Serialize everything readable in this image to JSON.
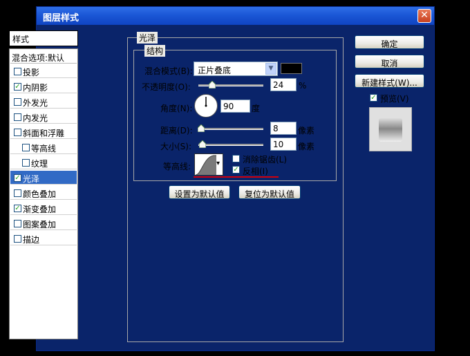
{
  "window": {
    "title": "图层样式",
    "close_glyph": "✕"
  },
  "style_list": {
    "header": "样式",
    "blend_options": "混合选项:默认",
    "items": [
      {
        "label": "投影",
        "checked": false,
        "sub": false,
        "selected": false
      },
      {
        "label": "内阴影",
        "checked": true,
        "sub": false,
        "selected": false
      },
      {
        "label": "外发光",
        "checked": false,
        "sub": false,
        "selected": false
      },
      {
        "label": "内发光",
        "checked": false,
        "sub": false,
        "selected": false
      },
      {
        "label": "斜面和浮雕",
        "checked": false,
        "sub": false,
        "selected": false
      },
      {
        "label": "等高线",
        "checked": false,
        "sub": true,
        "selected": false
      },
      {
        "label": "纹理",
        "checked": false,
        "sub": true,
        "selected": false
      },
      {
        "label": "光泽",
        "checked": true,
        "sub": false,
        "selected": true
      },
      {
        "label": "颜色叠加",
        "checked": false,
        "sub": false,
        "selected": false
      },
      {
        "label": "渐变叠加",
        "checked": true,
        "sub": false,
        "selected": false
      },
      {
        "label": "图案叠加",
        "checked": false,
        "sub": false,
        "selected": false
      },
      {
        "label": "描边",
        "checked": false,
        "sub": false,
        "selected": false
      }
    ],
    "check_glyph": "✓"
  },
  "satin": {
    "group_title": "光泽",
    "structure_title": "结构",
    "blend_mode_label": "混合模式(B):",
    "blend_mode_value": "正片叠底",
    "blend_color": "#000000",
    "opacity_label": "不透明度(O):",
    "opacity_value": "24",
    "opacity_unit": "%",
    "angle_label": "角度(N):",
    "angle_value": "90",
    "angle_unit": "度",
    "distance_label": "距离(D):",
    "distance_value": "8",
    "distance_unit": "像素",
    "size_label": "大小(S):",
    "size_value": "10",
    "size_unit": "像素",
    "contour_label": "等高线:",
    "anti_alias_label": "消除锯齿(L)",
    "anti_alias_checked": false,
    "invert_label": "反相(I)",
    "invert_checked": true,
    "reset_default_button": "设置为默认值",
    "restore_default_button": "复位为默认值"
  },
  "right_buttons": {
    "ok": "确定",
    "cancel": "取消",
    "new_style": "新建样式(W)...",
    "preview_label": "预览(V)",
    "preview_checked": true
  },
  "dropdown_glyph": "▼",
  "contour_arrow_glyph": "▾"
}
